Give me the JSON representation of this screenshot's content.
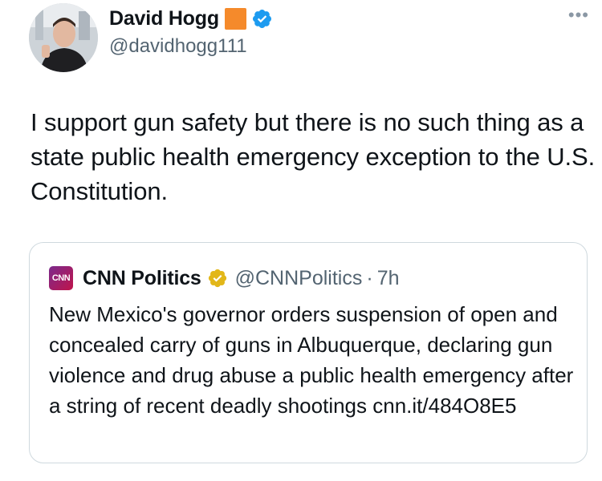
{
  "author": {
    "display_name": "David Hogg",
    "handle": "@davidhogg111",
    "flag_icon": "orange-square-icon",
    "verified_icon": "verified-badge-icon",
    "verified_color": "#1d9bf0"
  },
  "more_label": "•••",
  "tweet_text": "I support gun safety but there is no such thing as a state public health emergency exception to the U.S. Constitution.",
  "quote": {
    "logo_text": "CNN",
    "display_name": "CNN Politics",
    "verified_icon": "gold-verified-badge-icon",
    "verified_color": "#e2b719",
    "handle": "@CNNPolitics",
    "separator": "·",
    "time": "7h",
    "text": "New Mexico's governor orders suspension of open and concealed carry of guns in Albuquerque, declaring gun violence and drug abuse a public health emergency after a string of recent deadly shootings cnn.it/484O8E5"
  },
  "colors": {
    "text_primary": "#0f1419",
    "text_secondary": "#536471",
    "border": "#cfd9de",
    "flag": "#f58a2b"
  }
}
